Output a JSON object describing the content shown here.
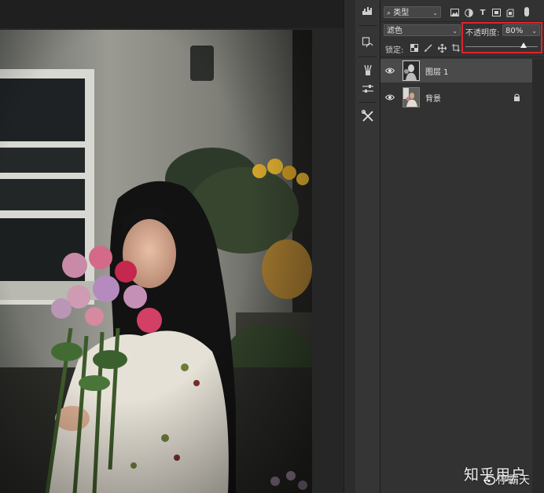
{
  "layers_panel": {
    "filter_label": "类型",
    "blend_mode": "滤色",
    "opacity_label": "不透明度:",
    "opacity_value": "80%",
    "opacity_level": 0.8,
    "lock_label": "锁定:",
    "filter_icons": [
      "image-filter-icon",
      "adjustment-filter-icon",
      "type-filter-icon",
      "shape-filter-icon",
      "smart-object-filter-icon"
    ],
    "lock_icons": [
      "lock-transparent-icon",
      "lock-paint-icon",
      "lock-move-icon",
      "lock-artboard-icon"
    ],
    "layers": [
      {
        "name": "图层 1",
        "visible": true,
        "selected": true,
        "locked": false
      },
      {
        "name": "背景",
        "visible": true,
        "selected": false,
        "locked": true
      }
    ]
  },
  "tools": [
    "histogram-icon",
    "paths-icon",
    "brushes-icon",
    "adjustments-icon",
    "tool-presets-icon"
  ],
  "watermark": {
    "main": "知乎用户",
    "sub": "停霸天"
  },
  "colors": {
    "highlight": "#e0232e",
    "panel_bg": "#323232",
    "selected_layer": "#4a4a4a"
  }
}
